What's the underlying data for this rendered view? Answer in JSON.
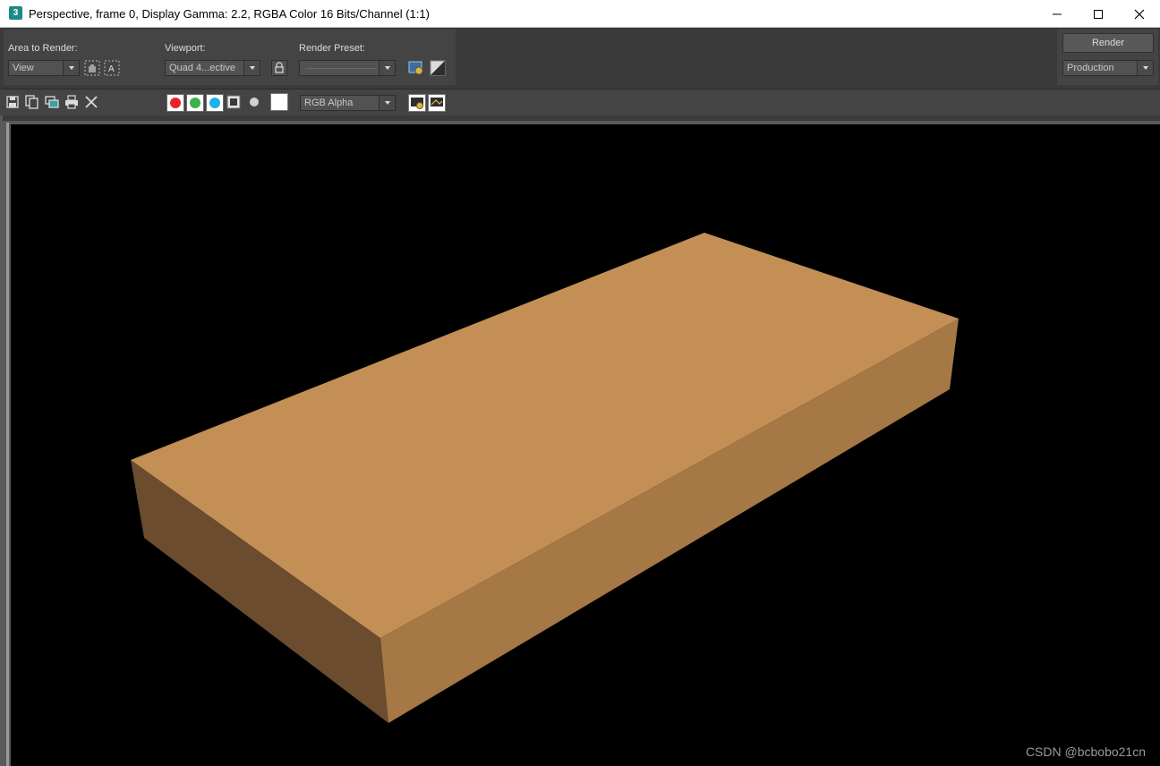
{
  "window": {
    "app_icon": "3",
    "title": "Perspective, frame 0, Display Gamma: 2.2, RGBA Color 16 Bits/Channel (1:1)"
  },
  "controls": {
    "area_to_render_label": "Area to Render:",
    "area_to_render_value": "View",
    "viewport_label": "Viewport:",
    "viewport_value": "Quad 4...ective",
    "render_preset_label": "Render Preset:",
    "render_preset_value": "",
    "render_button": "Render",
    "mode_value": "Production"
  },
  "toolbar": {
    "channel_display": "RGB Alpha",
    "channel_colors": {
      "red": "#e8232b",
      "green": "#3bb24a",
      "blue": "#1ab2e8",
      "alpha": "#8a8a8a"
    }
  },
  "render": {
    "background": "#000000",
    "box_top_color": "#c38f55",
    "box_side_color": "#a57845",
    "box_front_color": "#6b4c2f"
  },
  "watermark": "CSDN @bcbobo21cn"
}
